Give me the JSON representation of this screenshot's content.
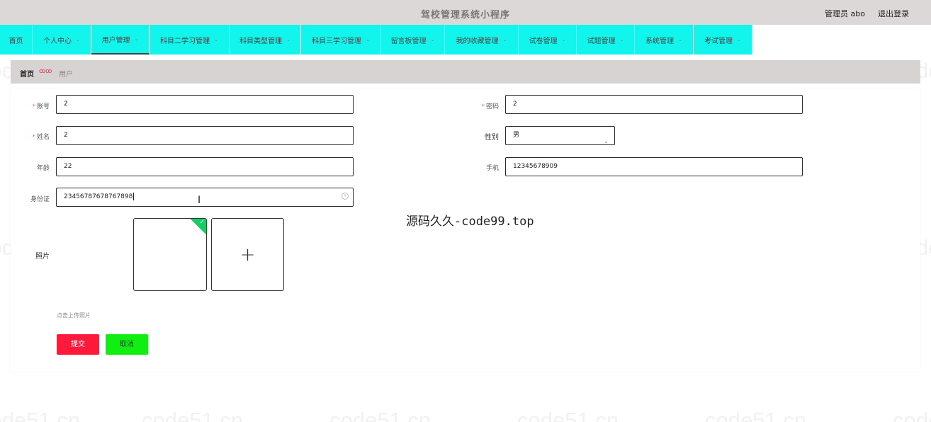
{
  "topbar": {
    "title": "驾校管理系统小程序",
    "user": "管理员 abo",
    "logout": "退出登录"
  },
  "nav": [
    {
      "label": "首页",
      "has_caret": false
    },
    {
      "label": "个人中心",
      "has_caret": true
    },
    {
      "label": "用户管理",
      "has_caret": true,
      "active": true
    },
    {
      "label": "科目二学习管理",
      "has_caret": true
    },
    {
      "label": "科目类型管理",
      "has_caret": true
    },
    {
      "label": "科目三学习管理",
      "has_caret": true
    },
    {
      "label": "留言板管理",
      "has_caret": true
    },
    {
      "label": "我的收藏管理",
      "has_caret": true
    },
    {
      "label": "试卷管理",
      "has_caret": true
    },
    {
      "label": "试题管理",
      "has_caret": true
    },
    {
      "label": "系统管理",
      "has_caret": true
    },
    {
      "label": "考试管理",
      "has_caret": true
    }
  ],
  "breadcrumb": {
    "home": "首页",
    "current": "用户"
  },
  "form": {
    "account_label": "账号",
    "account_value": "2",
    "password_label": "密码",
    "password_value": "2",
    "name_label": "姓名",
    "name_value": "2",
    "gender_label": "性别",
    "gender_value": "男",
    "age_label": "年龄",
    "age_value": "22",
    "phone_label": "手机",
    "phone_value": "12345678909",
    "idcard_label": "身份证",
    "idcard_value": "23456787678767898",
    "photo_label": "照片",
    "upload_hint": "点击上传照片"
  },
  "buttons": {
    "submit": "提交",
    "cancel": "取消"
  },
  "overlay_text": "源码久久-code99.top",
  "watermark": "code51.cn",
  "colors": {
    "nav_bg": "#12f5ec",
    "topbar_bg": "#ddd8d8",
    "submit_bg": "#ff1a3c",
    "cancel_bg": "#11ee11",
    "upload_check": "#13ce66"
  }
}
